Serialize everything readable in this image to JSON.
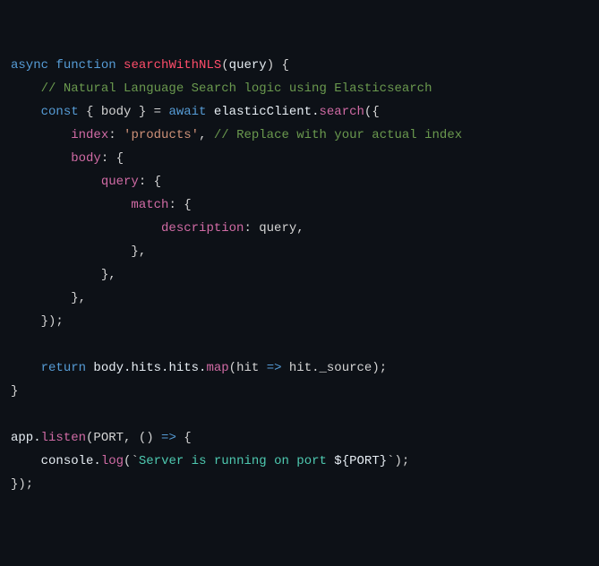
{
  "code": {
    "l1": {
      "kw_async": "async",
      "kw_function": "function",
      "fn_name": "searchWithNLS",
      "paren_open": "(",
      "param": "query",
      "paren_close_brace": ") {"
    },
    "l2": {
      "indent": "    ",
      "comment": "// Natural Language Search logic using Elasticsearch"
    },
    "l3": {
      "indent": "    ",
      "kw_const": "const",
      "destruct": " { body } = ",
      "kw_await": "await",
      "obj": " elasticClient.",
      "method": "search",
      "call_open": "({"
    },
    "l4": {
      "indent": "        ",
      "key": "index",
      "colon": ": ",
      "val": "'products'",
      "comma": ",",
      "comment": " // Replace with your actual index"
    },
    "l5": {
      "indent": "        ",
      "key": "body",
      "rest": ": {"
    },
    "l6": {
      "indent": "            ",
      "key": "query",
      "rest": ": {"
    },
    "l7": {
      "indent": "                ",
      "key": "match",
      "rest": ": {"
    },
    "l8": {
      "indent": "                    ",
      "key": "description",
      "rest": ": query,"
    },
    "l9": {
      "indent": "                ",
      "text": "},"
    },
    "l10": {
      "indent": "            ",
      "text": "},"
    },
    "l11": {
      "indent": "        ",
      "text": "},"
    },
    "l12": {
      "indent": "    ",
      "text": "});"
    },
    "l13": {
      "text": ""
    },
    "l14": {
      "indent": "    ",
      "kw_return": "return",
      "pre": " body.hits.hits.",
      "method": "map",
      "mid": "(hit ",
      "arrow": "=>",
      "post": " hit._source);"
    },
    "l15": {
      "text": "}"
    },
    "l16": {
      "text": ""
    },
    "l17": {
      "pre": "app.",
      "method": "listen",
      "mid": "(PORT, () ",
      "arrow": "=>",
      "post": " {"
    },
    "l18": {
      "indent": "    ",
      "obj": "console.",
      "method": "log",
      "open": "(`",
      "tstr1": "Server is running on port ",
      "interp_open": "${",
      "interp_var": "PORT",
      "interp_close": "}",
      "tstr2": "",
      "close": "`);"
    },
    "l19": {
      "text": "});"
    }
  }
}
